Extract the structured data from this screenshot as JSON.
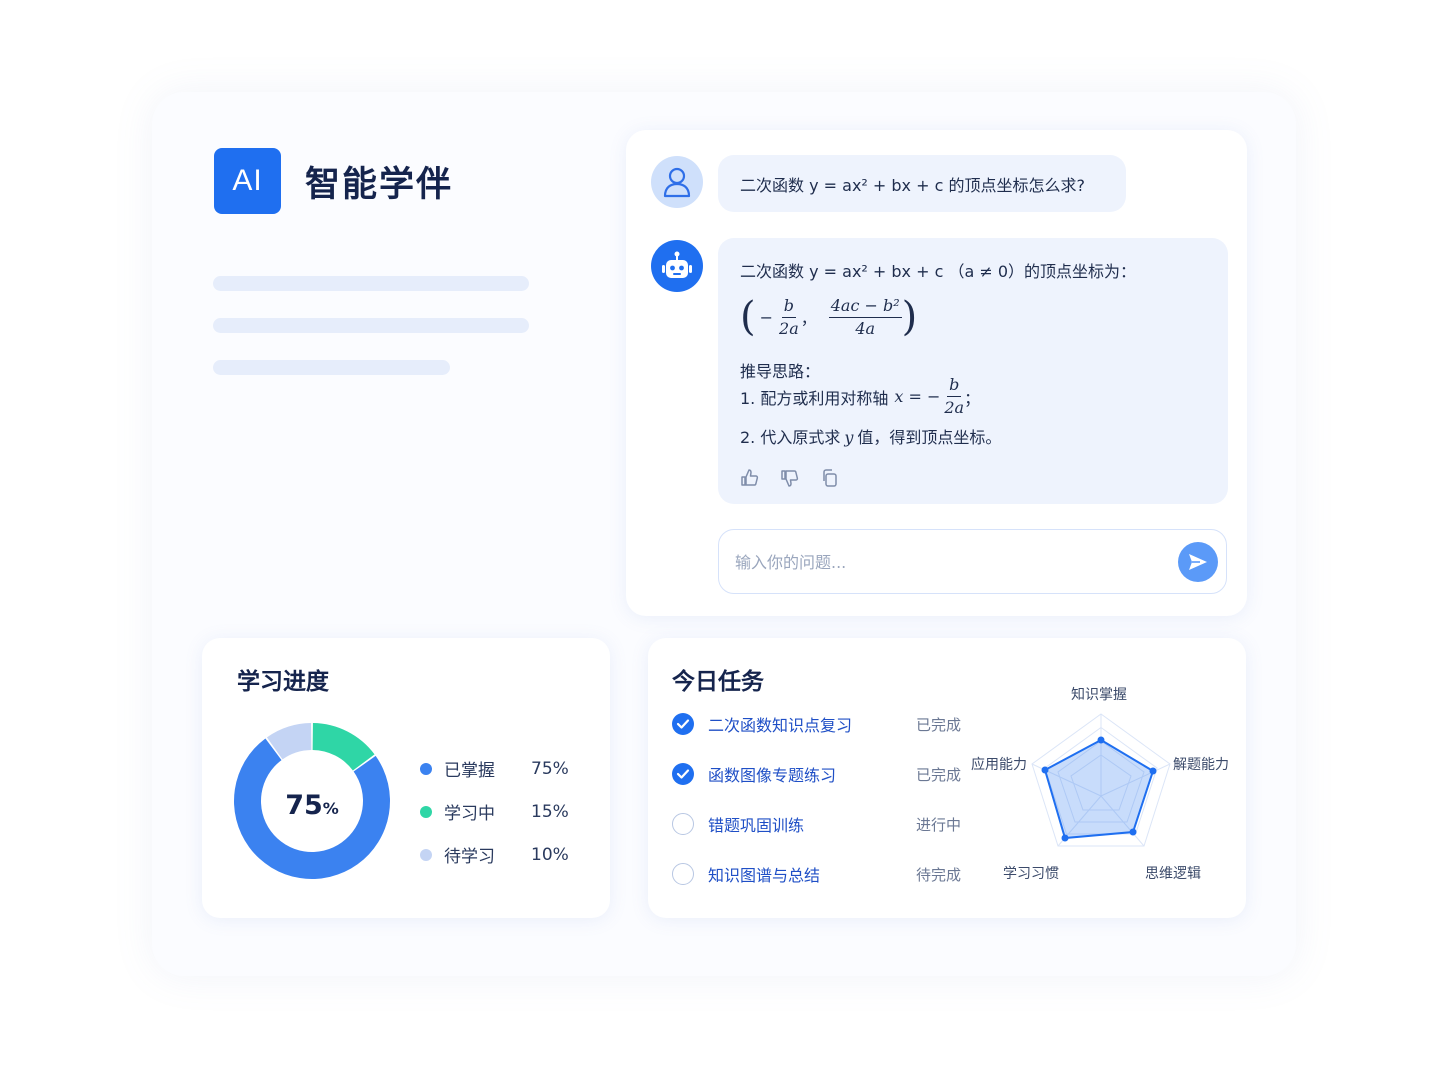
{
  "brand": {
    "logo_text": "AI",
    "title": "智能学伴",
    "accent": "#1f6ff0"
  },
  "chat": {
    "user_question": "二次函数 y = ax² + bx + c 的顶点坐标怎么求?",
    "answer": {
      "intro": "二次函数 y = ax² + bx + c （a ≠ 0）的顶点坐标为：",
      "vertex_x": {
        "sign": "−",
        "num": "b",
        "den": "2a"
      },
      "vertex_comma": "，",
      "vertex_y": {
        "num": "4ac − b²",
        "den": "4a"
      },
      "heading": "推导思路：",
      "step1_text": "1. 配方或利用对称轴",
      "step1_math": "x = −",
      "step1_frac": {
        "num": "b",
        "den": "2a"
      },
      "step1_end": "；",
      "step2_pre": "2. 代入原式求",
      "step2_var": "y",
      "step2_post": "值，得到顶点坐标。"
    },
    "actions": [
      "thumbs-up-icon",
      "thumbs-down-icon",
      "copy-icon"
    ],
    "input_placeholder": "输入你的问题..."
  },
  "progress": {
    "title": "学习进度",
    "center_value": "75",
    "center_unit": "%",
    "legend": [
      {
        "label": "已掌握",
        "value": "75%",
        "color": "#3b82f0"
      },
      {
        "label": "学习中",
        "value": "15%",
        "color": "#2fd6a6"
      },
      {
        "label": "待学习",
        "value": "10%",
        "color": "#c4d4f4"
      }
    ]
  },
  "chart_data": {
    "type": "pie",
    "categories": [
      "已掌握",
      "学习中",
      "待学习"
    ],
    "values": [
      75,
      15,
      10
    ]
  },
  "tasks": {
    "title": "今日任务",
    "items": [
      {
        "label": "二次函数知识点复习",
        "status": "已完成",
        "done": true
      },
      {
        "label": "函数图像专题练习",
        "status": "已完成",
        "done": true
      },
      {
        "label": "错题巩固训练",
        "status": "进行中",
        "done": false
      },
      {
        "label": "知识图谱与总结",
        "status": "待完成",
        "done": false
      }
    ]
  },
  "radar": {
    "labels": [
      "知识掌握",
      "解题能力",
      "思维逻辑",
      "学习习惯",
      "应用能力"
    ]
  }
}
